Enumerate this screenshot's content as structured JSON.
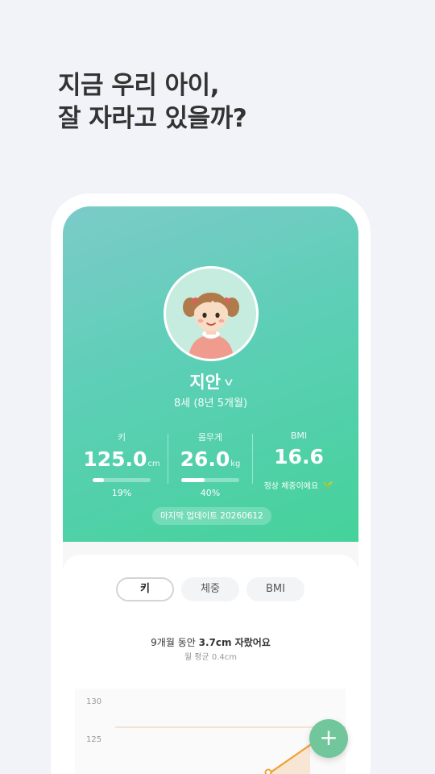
{
  "headline": {
    "line1": "지금 우리 아이,",
    "line2": "잘 자라고 있을까?"
  },
  "profile": {
    "name": "지안",
    "age": "8세 (8년 5개월)"
  },
  "stats": {
    "height": {
      "label": "키",
      "value": "125.0",
      "unit": "cm",
      "percentile": "19%",
      "percentile_value": 0.19
    },
    "weight": {
      "label": "몸무게",
      "value": "26.0",
      "unit": "kg",
      "percentile": "40%",
      "percentile_value": 0.4
    },
    "bmi": {
      "label": "BMI",
      "value": "16.6",
      "note": "정상 체중이에요"
    }
  },
  "last_updated": "마지막 업데이트 20260612",
  "tabs": [
    {
      "label": "키",
      "active": true
    },
    {
      "label": "체중",
      "active": false
    },
    {
      "label": "BMI",
      "active": false
    }
  ],
  "summary": {
    "prefix": "9개월 동안 ",
    "highlight": "3.7cm 자랐어요",
    "sub": "월 평균 0.4cm"
  },
  "chart_data": {
    "type": "line",
    "y_ticks": [
      "130",
      "125"
    ],
    "series_color": "#f0a030"
  },
  "fab": {
    "label": "+"
  },
  "colors": {
    "accent": "#45d29a",
    "fab": "#72c69c",
    "line": "#f0a030"
  }
}
